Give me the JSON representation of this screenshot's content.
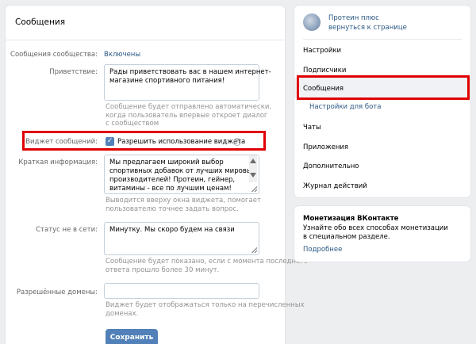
{
  "main": {
    "title": "Сообщения",
    "community_messages": {
      "label": "Сообщения сообщества:",
      "value": "Включены"
    },
    "greeting": {
      "label": "Приветствие:",
      "text_lines": [
        "Рады приветствовать вас в нашем интернет-",
        "магазине спортивного питания!"
      ],
      "hint_lines": [
        "Сообщение будет отправлено автоматически,",
        "когда пользователь впервые откроет диалог",
        "с сообществом"
      ]
    },
    "widget": {
      "label": "Виджет сообщений:",
      "checkbox_label": "Разрешить использование виджета",
      "checked": true
    },
    "short_info": {
      "label": "Краткая информация:",
      "text_lines": [
        "Мы предлагаем широкий выбор",
        "спортивных добавок от лучших мировых",
        "производителей! Протеин, гейнер,",
        "витамины - все по лучшим ценам!"
      ],
      "hint_lines": [
        "Выводится вверху окна виджета, помогает",
        "пользователю точнее задать вопрос."
      ]
    },
    "offline_status": {
      "label": "Статус не в сети:",
      "text": "Минутку. Мы скоро будем на связи",
      "hint_lines": [
        "Сообщение будет показано, если с момента последнего",
        "ответа прошло более 30 минут."
      ]
    },
    "allowed_domains": {
      "label": "Разрешённые домены:",
      "value": "",
      "hint_lines": [
        "Виджет будет отображаться только на перечисленных",
        "доменах."
      ]
    },
    "save_label": "Сохранить"
  },
  "sidebar": {
    "community_name": "Протеин плюс",
    "back_link": "вернуться к странице",
    "items": [
      {
        "label": "Настройки"
      },
      {
        "label": "Подписчики"
      },
      {
        "label": "Сообщения",
        "selected": true
      },
      {
        "label": "Настройки для бота",
        "sub": true
      },
      {
        "label": "Чаты"
      },
      {
        "label": "Приложения"
      },
      {
        "label": "Дополнительно"
      },
      {
        "label": "Журнал действий"
      }
    ]
  },
  "promo": {
    "title": "Монетизация ВКонтакте",
    "text_lines": [
      "Узнайте обо всех способах монетизации",
      "в специальном разделе."
    ],
    "link": "Подробнее"
  },
  "colors": {
    "accent": "#5181b8",
    "link": "#2a5885",
    "highlight": "#e00000",
    "background": "#edeef0"
  },
  "icons": [
    "checkbox-check-icon",
    "help-icon",
    "resize-handle-icon",
    "scroll-up-arrow-icon",
    "scroll-down-arrow-icon",
    "community-avatar-icon"
  ]
}
